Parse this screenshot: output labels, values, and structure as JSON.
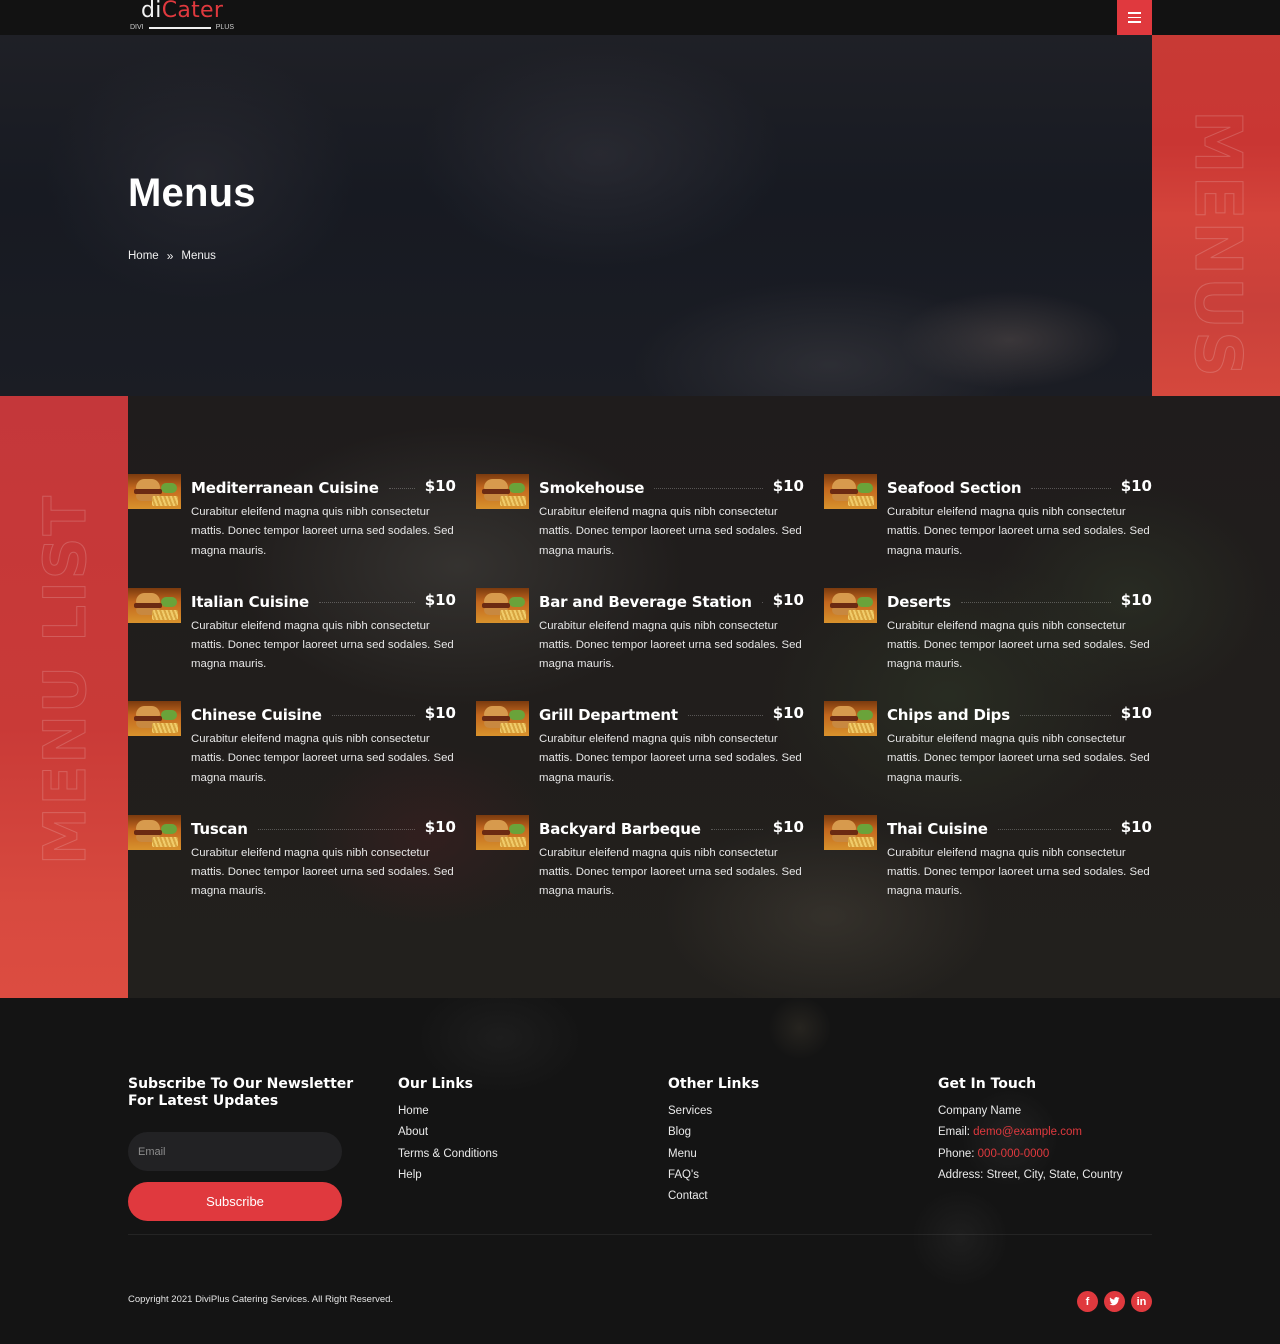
{
  "header": {
    "logo": {
      "part1": "di",
      "part2": "Cater",
      "sub_left": "DIVI",
      "sub_right": "PLUS"
    },
    "menu_button_icon": "hamburger-icon"
  },
  "hero": {
    "title": "Menus",
    "breadcrumb": [
      {
        "label": "Home"
      },
      {
        "label": "Menus"
      }
    ],
    "breadcrumb_separator": "»",
    "side_word": "MENUS"
  },
  "menu_section": {
    "side_word": "MENU LIST",
    "items": [
      {
        "title": "Mediterranean Cuisine",
        "price": "$10",
        "description": "Curabitur eleifend magna quis nibh consectetur mattis. Donec tempor laoreet urna sed sodales. Sed magna mauris."
      },
      {
        "title": "Smokehouse",
        "price": "$10",
        "description": "Curabitur eleifend magna quis nibh consectetur mattis. Donec tempor laoreet urna sed sodales. Sed magna mauris."
      },
      {
        "title": "Seafood Section",
        "price": "$10",
        "description": "Curabitur eleifend magna quis nibh consectetur mattis. Donec tempor laoreet urna sed sodales. Sed magna mauris."
      },
      {
        "title": "Italian Cuisine",
        "price": "$10",
        "description": "Curabitur eleifend magna quis nibh consectetur mattis. Donec tempor laoreet urna sed sodales. Sed magna mauris."
      },
      {
        "title": "Bar and Beverage Station",
        "price": "$10",
        "description": "Curabitur eleifend magna quis nibh consectetur mattis. Donec tempor laoreet urna sed sodales. Sed magna mauris."
      },
      {
        "title": "Deserts",
        "price": "$10",
        "description": "Curabitur eleifend magna quis nibh consectetur mattis. Donec tempor laoreet urna sed sodales. Sed magna mauris."
      },
      {
        "title": "Chinese Cuisine",
        "price": "$10",
        "description": "Curabitur eleifend magna quis nibh consectetur mattis. Donec tempor laoreet urna sed sodales. Sed magna mauris."
      },
      {
        "title": "Grill Department",
        "price": "$10",
        "description": "Curabitur eleifend magna quis nibh consectetur mattis. Donec tempor laoreet urna sed sodales. Sed magna mauris."
      },
      {
        "title": "Chips and Dips",
        "price": "$10",
        "description": "Curabitur eleifend magna quis nibh consectetur mattis. Donec tempor laoreet urna sed sodales. Sed magna mauris."
      },
      {
        "title": "Tuscan",
        "price": "$10",
        "description": "Curabitur eleifend magna quis nibh consectetur mattis. Donec tempor laoreet urna sed sodales. Sed magna mauris."
      },
      {
        "title": "Backyard Barbeque",
        "price": "$10",
        "description": "Curabitur eleifend magna quis nibh consectetur mattis. Donec tempor laoreet urna sed sodales. Sed magna mauris."
      },
      {
        "title": "Thai Cuisine",
        "price": "$10",
        "description": "Curabitur eleifend magna quis nibh consectetur mattis. Donec tempor laoreet urna sed sodales. Sed magna mauris."
      }
    ]
  },
  "footer": {
    "newsletter": {
      "heading_line1": "Subscribe To Our Newsletter",
      "heading_line2": "For Latest Updates",
      "email_placeholder": "Email",
      "email_value": "",
      "button_label": "Subscribe"
    },
    "our_links": {
      "heading": "Our Links",
      "items": [
        "Home",
        "About",
        "Terms & Conditions",
        "Help"
      ]
    },
    "other_links": {
      "heading": "Other Links",
      "items": [
        "Services",
        "Blog",
        "Menu",
        "FAQ's",
        "Contact"
      ]
    },
    "contact": {
      "heading": "Get In Touch",
      "company": "Company Name",
      "email_label": "Email: ",
      "email": "demo@example.com",
      "phone_label": "Phone: ",
      "phone": "000-000-0000",
      "address": "Address: Street, City, State, Country"
    },
    "copyright": "Copyright 2021 DiviPlus Catering Services. All Right Reserved.",
    "socials": [
      {
        "name": "facebook",
        "glyph": "f"
      },
      {
        "name": "twitter",
        "glyph": ""
      },
      {
        "name": "linkedin",
        "glyph": "in"
      }
    ]
  },
  "colors": {
    "accent": "#e0393e",
    "header_bg": "#121212",
    "footer_bg": "#141414"
  }
}
